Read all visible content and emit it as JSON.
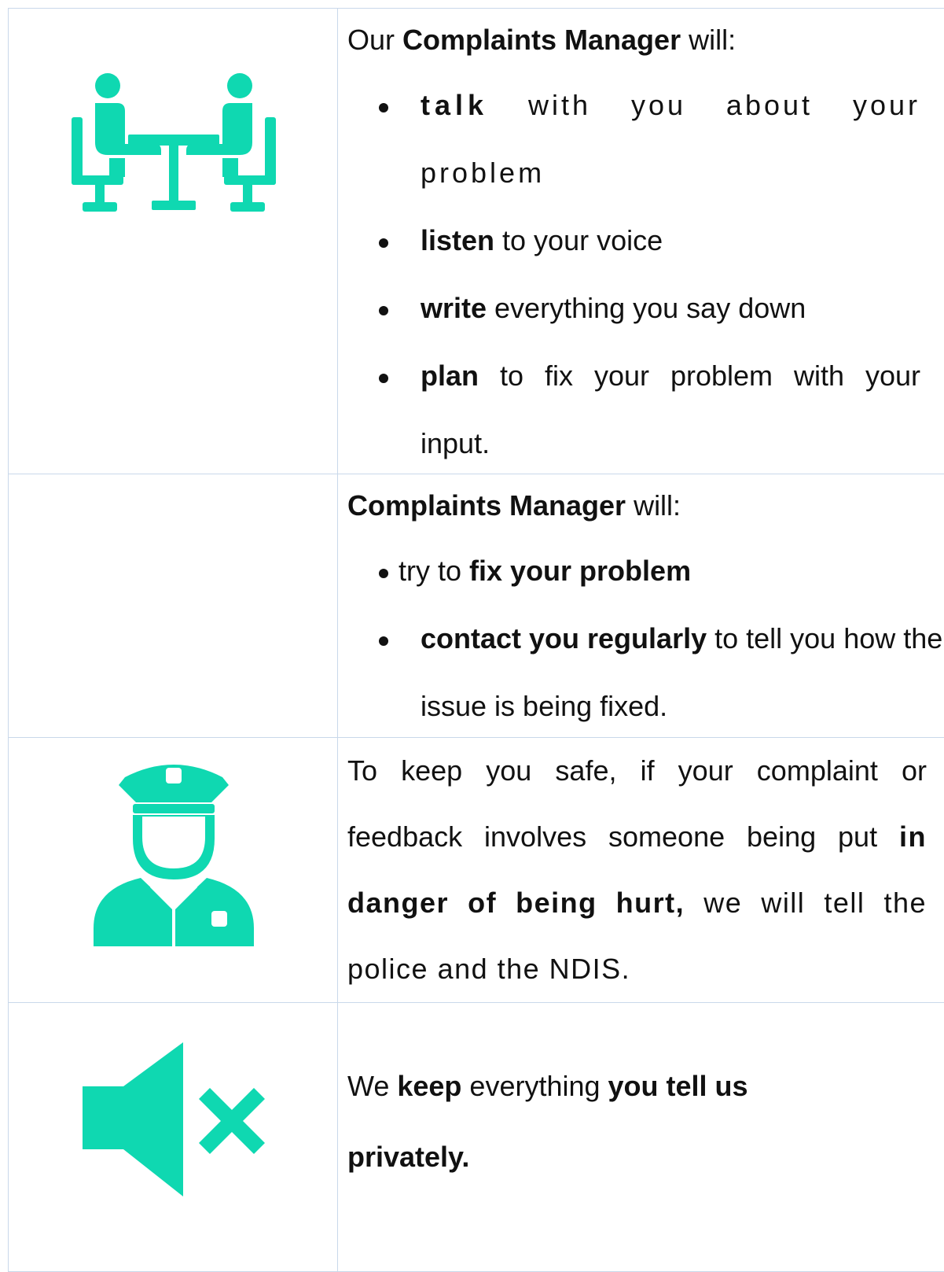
{
  "accent_color": "#0fd8b1",
  "rows": [
    {
      "icon": "meeting-table-icon",
      "intro_prefix": "Our ",
      "intro_bold": "Complaints Manager",
      "intro_suffix": " will:",
      "bullets": [
        {
          "bold": "talk",
          "rest": " with you about your problem"
        },
        {
          "bold": "listen",
          "rest": " to your voice"
        },
        {
          "bold": "write",
          "rest": " everything you say down"
        },
        {
          "bold": "plan",
          "rest": " to fix your problem with your input."
        }
      ]
    },
    {
      "icon": "",
      "intro_bold": "Complaints Manager",
      "intro_suffix": " will:",
      "bullets": [
        {
          "pre": "try to ",
          "bold": "fix your problem",
          "rest": ""
        },
        {
          "bold": "contact you regularly",
          "rest": " to tell you how the issue is being fixed."
        }
      ]
    },
    {
      "icon": "police-officer-icon",
      "text_1": "To keep you safe, if your complaint or feedback involves someone being put ",
      "bold": "in danger of being hurt,",
      "text_2": " we will tell the police and the NDIS."
    },
    {
      "icon": "mute-speaker-icon",
      "text_1": "We ",
      "bold_1": "keep",
      "text_2": " everything ",
      "bold_2": "you tell us privately."
    }
  ]
}
